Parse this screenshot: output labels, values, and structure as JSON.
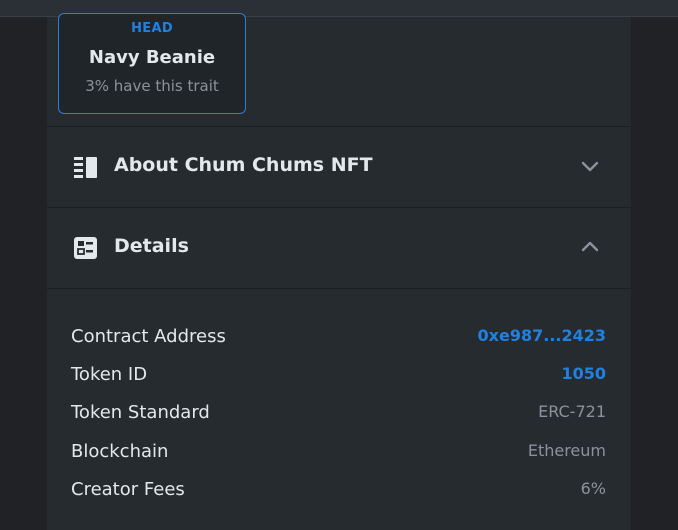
{
  "trait": {
    "type": "HEAD",
    "value": "Navy Beanie",
    "rarity": "3% have this trait"
  },
  "sections": {
    "about": {
      "title": "About Chum Chums NFT",
      "icon": "list-icon",
      "state": "collapsed"
    },
    "details": {
      "title": "Details",
      "icon": "details-icon",
      "state": "expanded"
    }
  },
  "details": {
    "rows": [
      {
        "label": "Contract Address",
        "value": "0xe987...2423",
        "link": true
      },
      {
        "label": "Token ID",
        "value": "1050",
        "link": true
      },
      {
        "label": "Token Standard",
        "value": "ERC-721",
        "link": false
      },
      {
        "label": "Blockchain",
        "value": "Ethereum",
        "link": false
      },
      {
        "label": "Creator Fees",
        "value": "6%",
        "link": false
      }
    ]
  },
  "colors": {
    "accent": "#2081e2",
    "panel": "#262b2f",
    "text": "#e5e8eb",
    "muted": "#8a939b"
  }
}
